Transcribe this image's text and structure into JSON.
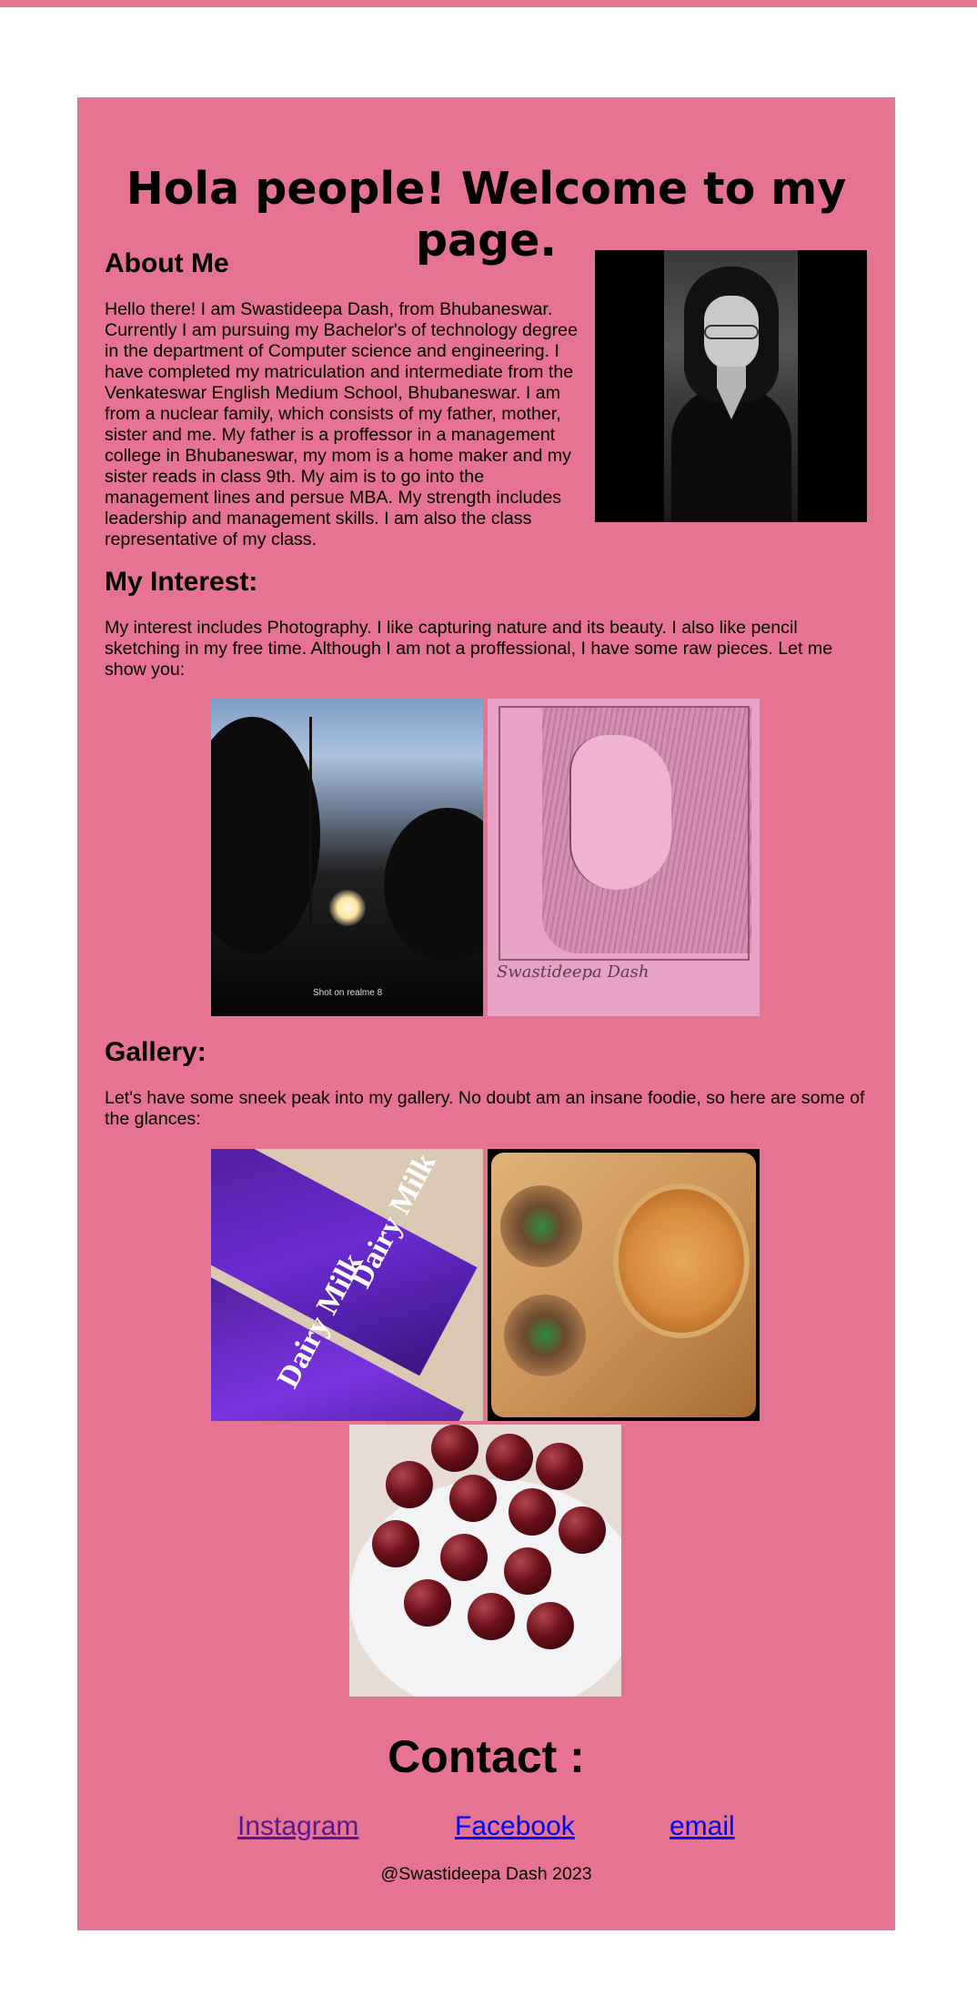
{
  "page": {
    "welcome": "Hola people! Welcome to my page."
  },
  "about": {
    "heading": "About Me",
    "text": "Hello there! I am Swastideepa Dash, from Bhubaneswar. Currently I am pursuing my Bachelor's of technology degree in the department of Computer science and engineering. I have completed my matriculation and intermediate from the Venkateswar English Medium School, Bhubaneswar. I am from a nuclear family, which consists of my father, mother, sister and me. My father is a proffessor in a management college in Bhubaneswar, my mom is a home maker and my sister reads in class 9th. My aim is to go into the management lines and persue MBA. My strength includes leadership and management skills. I am also the class representative of my class."
  },
  "interest": {
    "heading": "My Interest:",
    "text": "My interest includes Photography. I like capturing nature and its beauty. I also like pencil sketching in my free time. Although I am not a proffessional, I have some raw pieces. Let me show you:",
    "photo_watermark": "Shot on realme 8",
    "sketch_signature": "Swastideepa Dash"
  },
  "gallery": {
    "heading": "Gallery:",
    "text": "Let's have some sneek peak into my gallery. No doubt am an insane foodie, so here are some of the glances:",
    "chocolate_brand": "Dairy Milk"
  },
  "contact": {
    "heading": "Contact :",
    "links": [
      "Instagram",
      "Facebook",
      "email"
    ],
    "footer": "@Swastideepa Dash 2023"
  },
  "colors": {
    "accent": "#e77393",
    "visited_link": "#551a8b",
    "link": "#0000ee"
  }
}
